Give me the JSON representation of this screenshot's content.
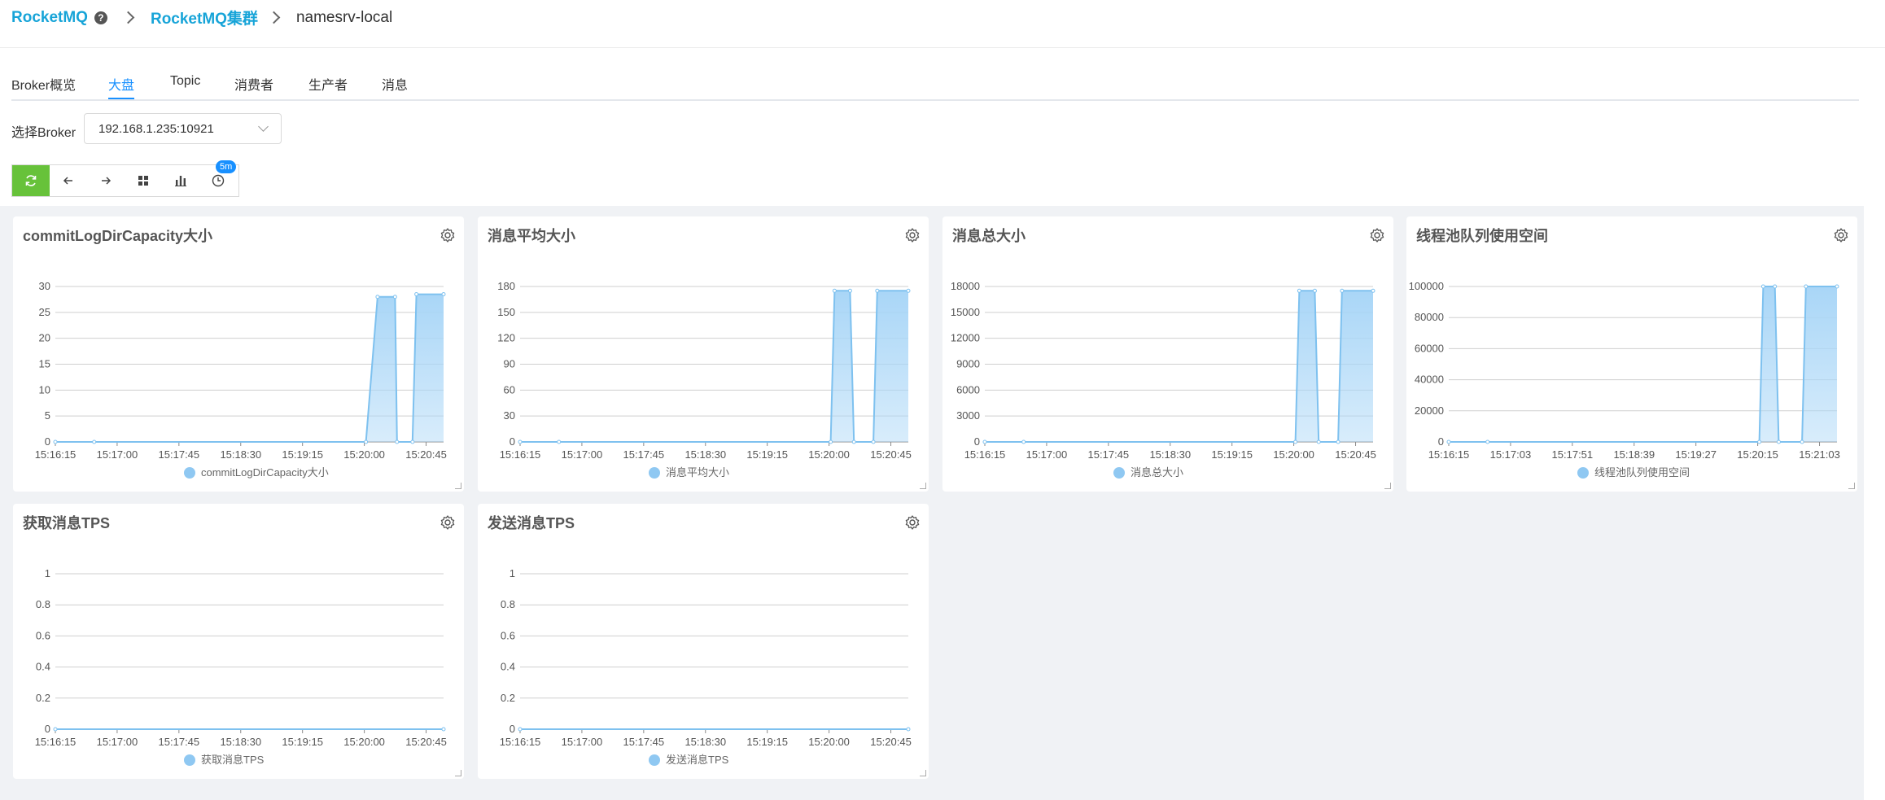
{
  "breadcrumb": {
    "root": "RocketMQ",
    "cluster": "RocketMQ集群",
    "current": "namesrv-local"
  },
  "tabs": [
    {
      "label": "Broker概览",
      "active": false
    },
    {
      "label": "大盘",
      "active": true
    },
    {
      "label": "Topic",
      "active": false
    },
    {
      "label": "消费者",
      "active": false
    },
    {
      "label": "生产者",
      "active": false
    },
    {
      "label": "消息",
      "active": false
    }
  ],
  "broker_select": {
    "label": "选择Broker",
    "value": "192.168.1.235:10921"
  },
  "toolbar": {
    "icons": [
      "refresh-icon",
      "arrow-left-icon",
      "arrow-right-icon",
      "grid-icon",
      "bar-chart-icon",
      "clock-icon"
    ],
    "interval_badge": "5m"
  },
  "colors": {
    "accent": "#1890ff",
    "brand": "#17a4d8",
    "refresh": "#67c23a",
    "series_line": "#7ec1ef",
    "series_fill": "#a9d6f7"
  },
  "chart_data": [
    {
      "type": "area",
      "title": "commitLogDirCapacity大小",
      "x": [
        "15:16:15",
        "15:17:00",
        "15:17:45",
        "15:18:30",
        "15:19:15",
        "15:20:00",
        "15:20:45"
      ],
      "yticks": [
        0,
        5,
        10,
        15,
        20,
        25,
        30
      ],
      "ylim": [
        0,
        30
      ],
      "series": [
        {
          "name": "commitLogDirCapacity大小",
          "points": [
            [
              0,
              0
            ],
            [
              0.1,
              0
            ],
            [
              0.8,
              0
            ],
            [
              0.83,
              28
            ],
            [
              0.875,
              28
            ],
            [
              0.88,
              0
            ],
            [
              0.92,
              0
            ],
            [
              0.93,
              28.5
            ],
            [
              1,
              28.5
            ]
          ]
        }
      ]
    },
    {
      "type": "area",
      "title": "消息平均大小",
      "x": [
        "15:16:15",
        "15:17:00",
        "15:17:45",
        "15:18:30",
        "15:19:15",
        "15:20:00",
        "15:20:45"
      ],
      "yticks": [
        0,
        30,
        60,
        90,
        120,
        150,
        180
      ],
      "ylim": [
        0,
        180
      ],
      "series": [
        {
          "name": "消息平均大小",
          "points": [
            [
              0,
              0
            ],
            [
              0.1,
              0
            ],
            [
              0.8,
              0
            ],
            [
              0.81,
              175
            ],
            [
              0.85,
              175
            ],
            [
              0.86,
              0
            ],
            [
              0.91,
              0
            ],
            [
              0.92,
              175
            ],
            [
              1,
              175
            ]
          ]
        }
      ]
    },
    {
      "type": "area",
      "title": "消息总大小",
      "x": [
        "15:16:15",
        "15:17:00",
        "15:17:45",
        "15:18:30",
        "15:19:15",
        "15:20:00",
        "15:20:45"
      ],
      "yticks": [
        0,
        3000,
        6000,
        9000,
        12000,
        15000,
        18000
      ],
      "ylim": [
        0,
        18000
      ],
      "series": [
        {
          "name": "消息总大小",
          "points": [
            [
              0,
              0
            ],
            [
              0.1,
              0
            ],
            [
              0.8,
              0
            ],
            [
              0.81,
              17500
            ],
            [
              0.85,
              17500
            ],
            [
              0.86,
              0
            ],
            [
              0.91,
              0
            ],
            [
              0.92,
              17500
            ],
            [
              1,
              17500
            ]
          ]
        }
      ]
    },
    {
      "type": "area",
      "title": "线程池队列使用空间",
      "x": [
        "15:16:15",
        "15:17:03",
        "15:17:51",
        "15:18:39",
        "15:19:27",
        "15:20:15",
        "15:21:03"
      ],
      "yticks": [
        0,
        20000,
        40000,
        60000,
        80000,
        100000
      ],
      "ylim": [
        0,
        100000
      ],
      "series": [
        {
          "name": "线程池队列使用空间",
          "points": [
            [
              0,
              0
            ],
            [
              0.1,
              0
            ],
            [
              0.8,
              0
            ],
            [
              0.81,
              100000
            ],
            [
              0.84,
              100000
            ],
            [
              0.85,
              0
            ],
            [
              0.91,
              0
            ],
            [
              0.92,
              100000
            ],
            [
              1,
              100000
            ]
          ]
        }
      ]
    },
    {
      "type": "line",
      "title": "获取消息TPS",
      "x": [
        "15:16:15",
        "15:17:00",
        "15:17:45",
        "15:18:30",
        "15:19:15",
        "15:20:00",
        "15:20:45"
      ],
      "yticks": [
        0,
        0.2,
        0.4,
        0.6,
        0.8,
        1
      ],
      "ylim": [
        0,
        1
      ],
      "series": [
        {
          "name": "获取消息TPS",
          "points": [
            [
              0,
              0
            ],
            [
              1,
              0
            ]
          ]
        }
      ]
    },
    {
      "type": "line",
      "title": "发送消息TPS",
      "x": [
        "15:16:15",
        "15:17:00",
        "15:17:45",
        "15:18:30",
        "15:19:15",
        "15:20:00",
        "15:20:45"
      ],
      "yticks": [
        0,
        0.2,
        0.4,
        0.6,
        0.8,
        1
      ],
      "ylim": [
        0,
        1
      ],
      "series": [
        {
          "name": "发送消息TPS",
          "points": [
            [
              0,
              0
            ],
            [
              1,
              0
            ]
          ]
        }
      ]
    }
  ]
}
